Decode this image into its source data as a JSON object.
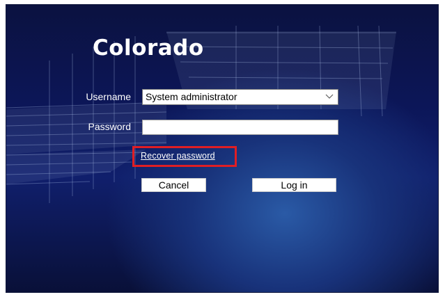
{
  "app": {
    "title": "Colorado"
  },
  "form": {
    "username_label": "Username",
    "username_value": "System administrator",
    "password_label": "Password",
    "password_value": "",
    "recover_link": "Recover password"
  },
  "buttons": {
    "cancel": "Cancel",
    "login": "Log in"
  },
  "colors": {
    "background_dark": "#0b1240",
    "background_glow": "#2a5aa6",
    "highlight": "#e01e24"
  },
  "icons": {
    "dropdown": "chevron-down-icon"
  }
}
